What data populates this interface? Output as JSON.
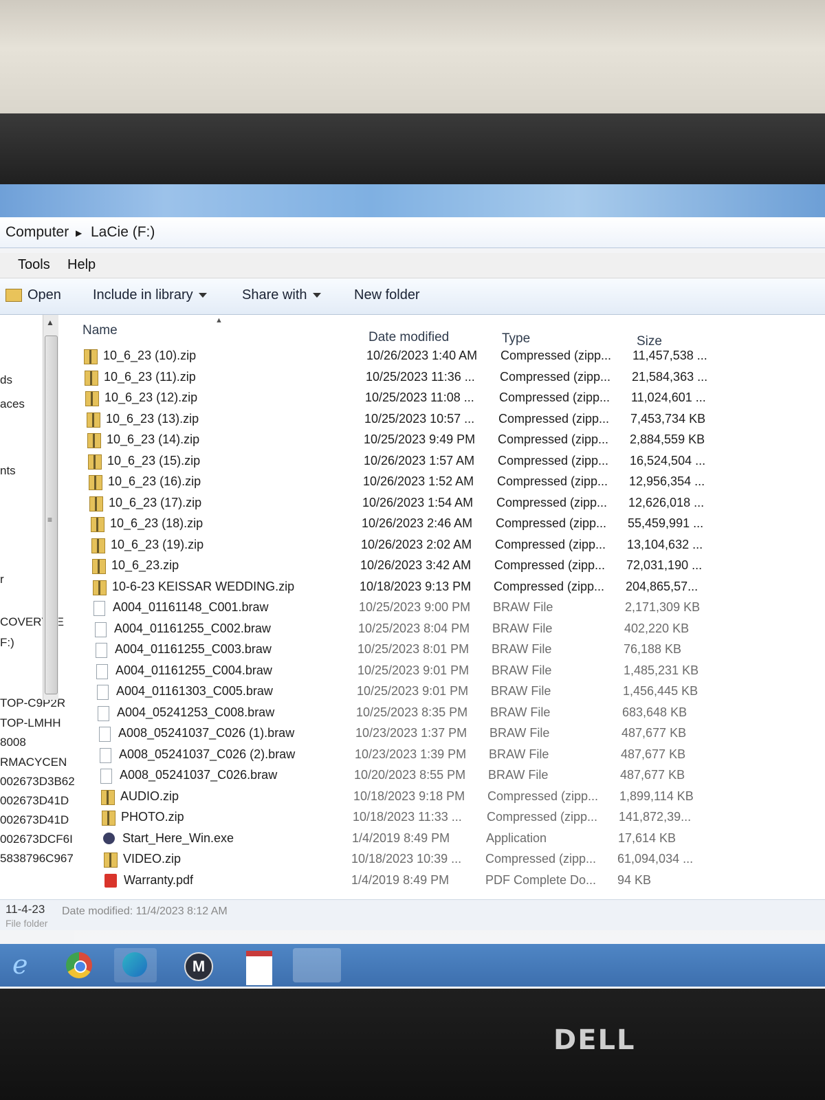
{
  "breadcrumb": {
    "part1": "Computer",
    "part2": "LaCie (F:)"
  },
  "menu": [
    "Tools",
    "Help"
  ],
  "toolbar": {
    "open": "Open",
    "include": "Include in library",
    "share": "Share with",
    "new_folder": "New folder"
  },
  "nav_items": [
    "ds",
    "aces",
    "nts",
    "r",
    "COVERY (E",
    "F:)",
    "TOP-C9P2R",
    "TOP-LMHH",
    "8008",
    "RMACYCEN",
    "002673D3B62",
    "002673D41D",
    "002673D41D",
    "002673DCF6I",
    "5838796C967"
  ],
  "columns": {
    "name": "Name",
    "date": "Date modified",
    "type": "Type",
    "size": "Size"
  },
  "files": [
    {
      "name": "10_6_23 (10).zip",
      "date": "10/26/2023 1:40 AM",
      "type": "Compressed (zipp...",
      "size": "11,457,538 ...",
      "icon": "zip-folder-icon"
    },
    {
      "name": "10_6_23 (11).zip",
      "date": "10/25/2023 11:36 ...",
      "type": "Compressed (zipp...",
      "size": "21,584,363 ...",
      "icon": "zip-folder-icon"
    },
    {
      "name": "10_6_23 (12).zip",
      "date": "10/25/2023 11:08 ...",
      "type": "Compressed (zipp...",
      "size": "11,024,601 ...",
      "icon": "zip-folder-icon"
    },
    {
      "name": "10_6_23 (13).zip",
      "date": "10/25/2023 10:57 ...",
      "type": "Compressed (zipp...",
      "size": "7,453,734 KB",
      "icon": "zip-folder-icon"
    },
    {
      "name": "10_6_23 (14).zip",
      "date": "10/25/2023 9:49 PM",
      "type": "Compressed (zipp...",
      "size": "2,884,559 KB",
      "icon": "zip-folder-icon"
    },
    {
      "name": "10_6_23 (15).zip",
      "date": "10/26/2023 1:57 AM",
      "type": "Compressed (zipp...",
      "size": "16,524,504 ...",
      "icon": "zip-folder-icon"
    },
    {
      "name": "10_6_23 (16).zip",
      "date": "10/26/2023 1:52 AM",
      "type": "Compressed (zipp...",
      "size": "12,956,354 ...",
      "icon": "zip-folder-icon"
    },
    {
      "name": "10_6_23 (17).zip",
      "date": "10/26/2023 1:54 AM",
      "type": "Compressed (zipp...",
      "size": "12,626,018 ...",
      "icon": "zip-folder-icon"
    },
    {
      "name": "10_6_23 (18).zip",
      "date": "10/26/2023 2:46 AM",
      "type": "Compressed (zipp...",
      "size": "55,459,991 ...",
      "icon": "zip-folder-icon"
    },
    {
      "name": "10_6_23 (19).zip",
      "date": "10/26/2023 2:02 AM",
      "type": "Compressed (zipp...",
      "size": "13,104,632 ...",
      "icon": "zip-folder-icon"
    },
    {
      "name": "10_6_23.zip",
      "date": "10/26/2023 3:42 AM",
      "type": "Compressed (zipp...",
      "size": "72,031,190 ...",
      "icon": "zip-folder-icon"
    },
    {
      "name": "10-6-23 KEISSAR WEDDING.zip",
      "date": "10/18/2023 9:13 PM",
      "type": "Compressed (zipp...",
      "size": "204,865,57...",
      "icon": "zip-folder-icon"
    },
    {
      "name": "A004_01161148_C001.braw",
      "date": "10/25/2023 9:00 PM",
      "type": "BRAW File",
      "size": "2,171,309 KB",
      "icon": "file-icon"
    },
    {
      "name": "A004_01161255_C002.braw",
      "date": "10/25/2023 8:04 PM",
      "type": "BRAW File",
      "size": "402,220 KB",
      "icon": "file-icon"
    },
    {
      "name": "A004_01161255_C003.braw",
      "date": "10/25/2023 8:01 PM",
      "type": "BRAW File",
      "size": "76,188 KB",
      "icon": "file-icon"
    },
    {
      "name": "A004_01161255_C004.braw",
      "date": "10/25/2023 9:01 PM",
      "type": "BRAW File",
      "size": "1,485,231 KB",
      "icon": "file-icon"
    },
    {
      "name": "A004_01161303_C005.braw",
      "date": "10/25/2023 9:01 PM",
      "type": "BRAW File",
      "size": "1,456,445 KB",
      "icon": "file-icon"
    },
    {
      "name": "A004_05241253_C008.braw",
      "date": "10/25/2023 8:35 PM",
      "type": "BRAW File",
      "size": "683,648 KB",
      "icon": "file-icon"
    },
    {
      "name": "A008_05241037_C026 (1).braw",
      "date": "10/23/2023 1:37 PM",
      "type": "BRAW File",
      "size": "487,677 KB",
      "icon": "file-icon"
    },
    {
      "name": "A008_05241037_C026 (2).braw",
      "date": "10/23/2023 1:39 PM",
      "type": "BRAW File",
      "size": "487,677 KB",
      "icon": "file-icon"
    },
    {
      "name": "A008_05241037_C026.braw",
      "date": "10/20/2023 8:55 PM",
      "type": "BRAW File",
      "size": "487,677 KB",
      "icon": "file-icon"
    },
    {
      "name": "AUDIO.zip",
      "date": "10/18/2023 9:18 PM",
      "type": "Compressed (zipp...",
      "size": "1,899,114 KB",
      "icon": "zip-folder-icon"
    },
    {
      "name": "PHOTO.zip",
      "date": "10/18/2023 11:33 ...",
      "type": "Compressed (zipp...",
      "size": "141,872,39...",
      "icon": "zip-folder-icon"
    },
    {
      "name": "Start_Here_Win.exe",
      "date": "1/4/2019 8:49 PM",
      "type": "Application",
      "size": "17,614 KB",
      "icon": "application-icon"
    },
    {
      "name": "VIDEO.zip",
      "date": "10/18/2023 10:39 ...",
      "type": "Compressed (zipp...",
      "size": "61,094,034 ...",
      "icon": "zip-folder-icon"
    },
    {
      "name": "Warranty.pdf",
      "date": "1/4/2019 8:49 PM",
      "type": "PDF Complete Do...",
      "size": "94 KB",
      "icon": "pdf-icon"
    }
  ],
  "status": {
    "name": "11-4-23",
    "detail": "Date modified: 11/4/2023 8:12 AM",
    "type": "File folder"
  },
  "monitor_brand": "DELL",
  "taskbar": {
    "m_label": "M"
  }
}
